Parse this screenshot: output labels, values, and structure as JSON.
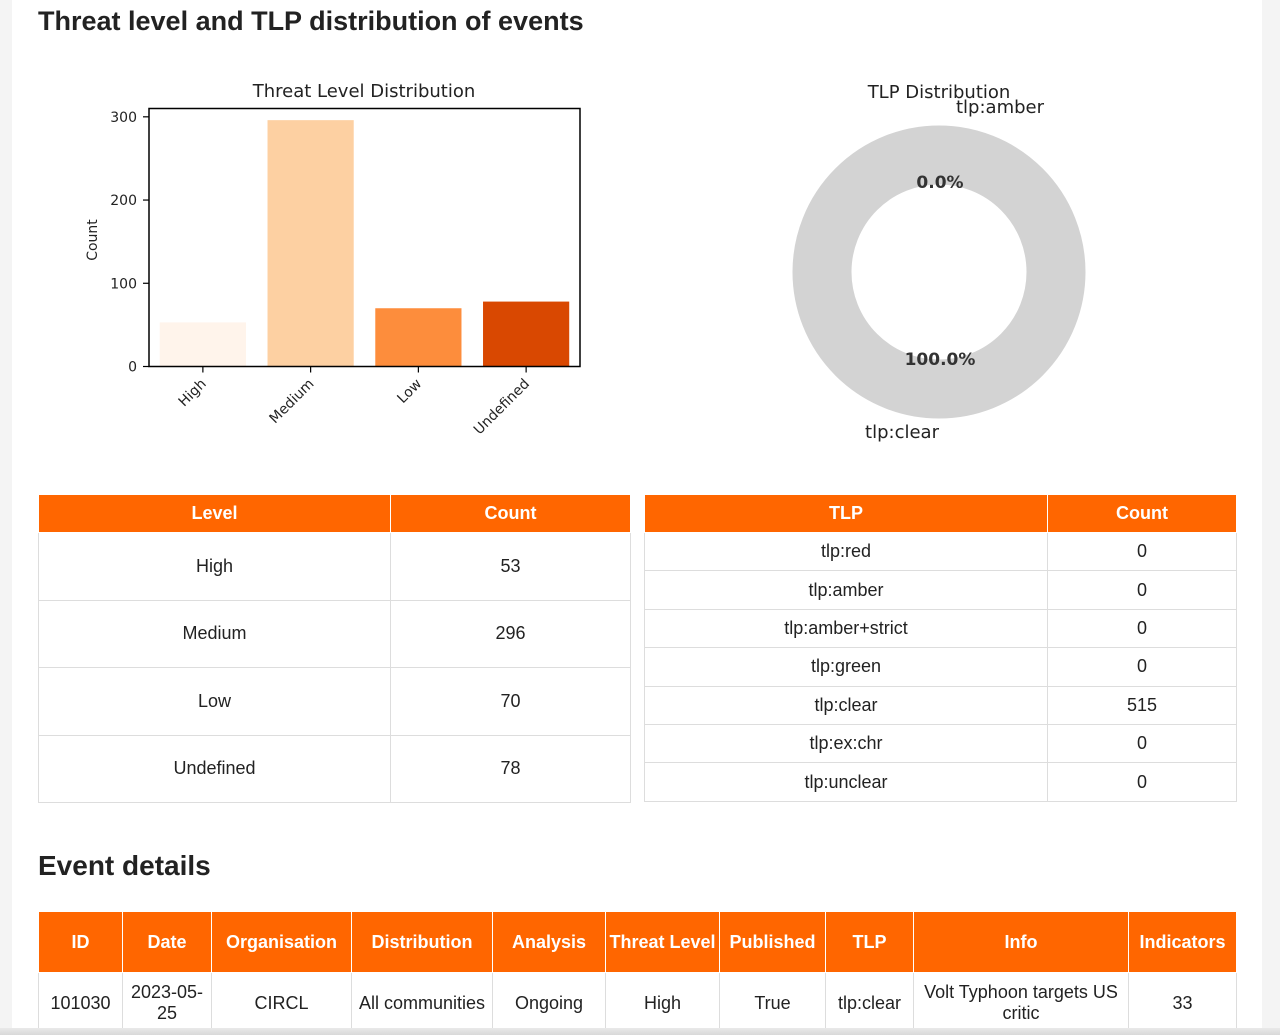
{
  "section_title": "Threat level and TLP distribution of events",
  "events_title": "Event details",
  "colors": {
    "accent": "#ff6600",
    "bar_high": "#fff4eb",
    "bar_medium": "#fdd0a2",
    "bar_low": "#fd8d3c",
    "bar_undefined": "#d94801",
    "donut": "#d3d3d3"
  },
  "chart_data": [
    {
      "type": "bar",
      "title": "Threat Level Distribution",
      "ylabel": "Count",
      "xlabel": "",
      "categories": [
        "High",
        "Medium",
        "Low",
        "Undefined"
      ],
      "values": [
        53,
        296,
        70,
        78
      ],
      "ylim": [
        0,
        310
      ],
      "yticks": [
        "0",
        "100",
        "200",
        "300"
      ],
      "grid": false
    },
    {
      "type": "pie",
      "title": "TLP Distribution",
      "labels": [
        "tlp:red",
        "tlp:amber",
        "tlp:amber+strict",
        "tlp:green",
        "tlp:clear",
        "tlp:ex:chr",
        "tlp:unclear"
      ],
      "values": [
        0,
        0,
        0,
        0,
        515,
        0,
        0
      ],
      "pct_labels": [
        "0.0%",
        "100.0%"
      ],
      "outer_labels": [
        "tlp:amber",
        "tlp:clear"
      ],
      "donut": true
    }
  ],
  "level_table": {
    "headers": [
      "Level",
      "Count"
    ],
    "rows": [
      [
        "High",
        "53"
      ],
      [
        "Medium",
        "296"
      ],
      [
        "Low",
        "70"
      ],
      [
        "Undefined",
        "78"
      ]
    ]
  },
  "tlp_table": {
    "headers": [
      "TLP",
      "Count"
    ],
    "rows": [
      [
        "tlp:red",
        "0"
      ],
      [
        "tlp:amber",
        "0"
      ],
      [
        "tlp:amber+strict",
        "0"
      ],
      [
        "tlp:green",
        "0"
      ],
      [
        "tlp:clear",
        "515"
      ],
      [
        "tlp:ex:chr",
        "0"
      ],
      [
        "tlp:unclear",
        "0"
      ]
    ]
  },
  "events_table": {
    "headers": [
      "ID",
      "Date",
      "Organisation",
      "Distribution",
      "Analysis",
      "Threat Level",
      "Published",
      "TLP",
      "Info",
      "Indicators"
    ],
    "rows": [
      [
        "101030",
        "2023-05-25",
        "CIRCL",
        "All communities",
        "Ongoing",
        "High",
        "True",
        "tlp:clear",
        "Volt Typhoon targets US critic",
        "33"
      ]
    ]
  }
}
